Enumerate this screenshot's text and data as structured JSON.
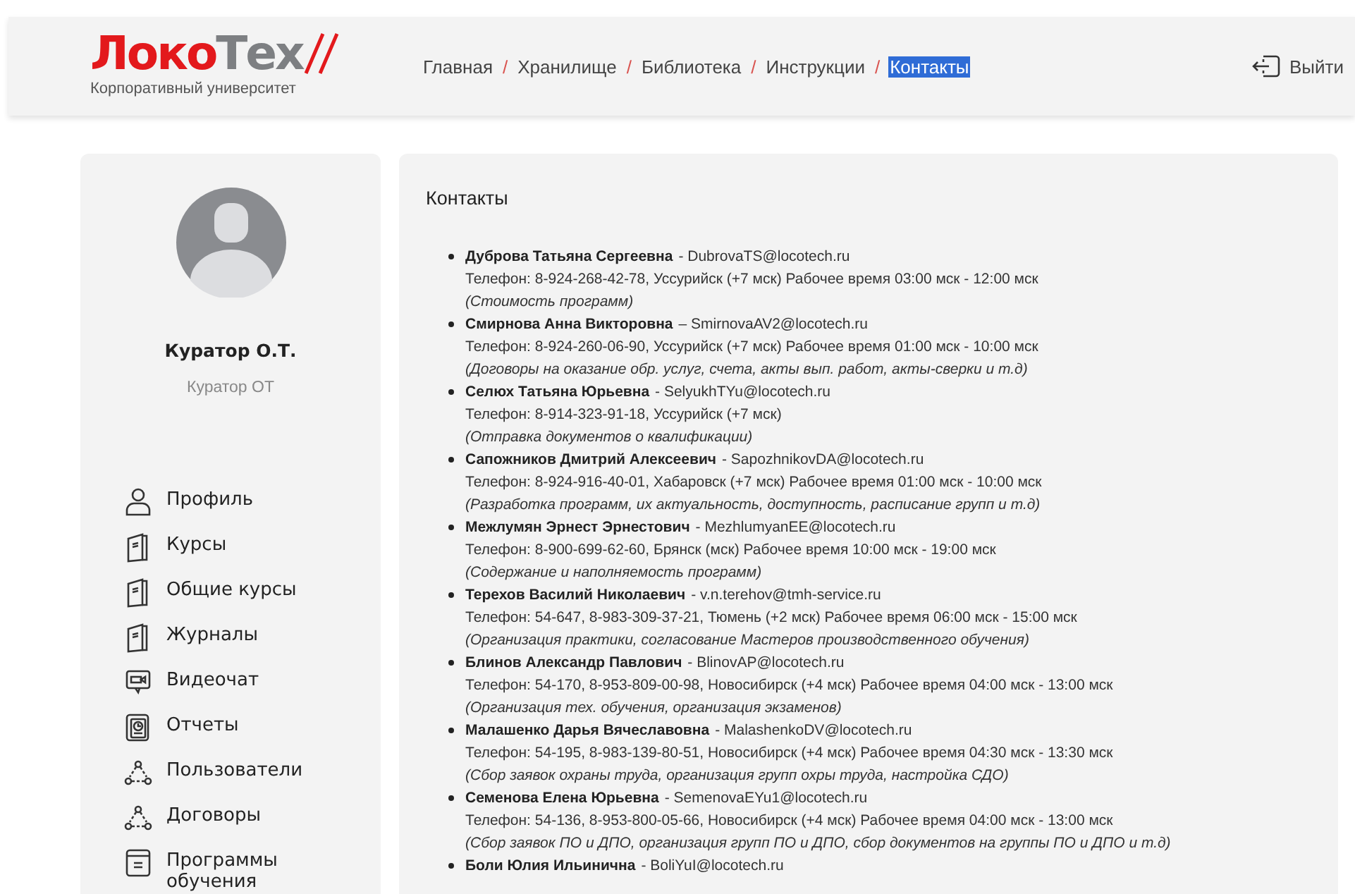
{
  "header": {
    "logo": {
      "part_1": "Локо",
      "part_2": "Тех",
      "subtitle": "Корпоративный университет"
    },
    "breadcrumbs": [
      {
        "label": "Главная",
        "separator": "/",
        "selected": false
      },
      {
        "label": "Хранилище",
        "separator": "/",
        "selected": false
      },
      {
        "label": "Библиотека",
        "separator": "/",
        "selected": false
      },
      {
        "label": "Инструкции",
        "separator": "/",
        "selected": false
      },
      {
        "label": "Контакты",
        "selected": true
      }
    ],
    "logout": "Выйти"
  },
  "sidebar": {
    "user_name": "Куратор О.Т.",
    "user_role": "Куратор ОТ",
    "menu": [
      {
        "label": "Профиль",
        "kind": "person"
      },
      {
        "label": "Курсы",
        "kind": "book"
      },
      {
        "label": "Общие курсы",
        "kind": "book"
      },
      {
        "label": "Журналы",
        "kind": "book"
      },
      {
        "label": "Видеочат",
        "kind": "video"
      },
      {
        "label": "Отчеты",
        "kind": "report"
      },
      {
        "label": "Пользователи",
        "kind": "network"
      },
      {
        "label": "Договоры",
        "kind": "network"
      },
      {
        "label": "Программы обучения",
        "kind": "program"
      }
    ]
  },
  "contacts": {
    "title": "Контакты",
    "items": [
      {
        "name": "Дуброва Татьяна Сергеевна",
        "separator": "-",
        "email": "DubrovaTS@locotech.ru",
        "phone": "Телефон: 8-924-268-42-78, Уссурийск (+7 мск) Рабочее время 03:00 мск - 12:00 мск",
        "note": "(Стоимость программ)"
      },
      {
        "name": "Смирнова Анна Викторовна",
        "separator": "–",
        "email": "SmirnovaAV2@locotech.ru",
        "phone": "Телефон: 8-924-260-06-90, Уссурийск (+7 мск) Рабочее время 01:00 мск - 10:00 мск",
        "note": "(Договоры на оказание обр. услуг, счета, акты вып. работ, акты-сверки и т.д)"
      },
      {
        "name": "Селюх Татьяна Юрьевна",
        "separator": "-",
        "email": "SelyukhTYu@locotech.ru",
        "phone": "Телефон: 8-914-323-91-18, Уссурийск (+7 мск)",
        "note": "(Отправка документов о квалификации)"
      },
      {
        "name": "Сапожников Дмитрий Алексеевич",
        "separator": "-",
        "email": "SapozhnikovDA@locotech.ru",
        "phone": "Телефон: 8-924-916-40-01, Хабаровск (+7 мск) Рабочее время 01:00 мск - 10:00 мск",
        "note": "(Разработка программ, их актуальность, доступность, расписание групп и т.д)"
      },
      {
        "name": "Межлумян Эрнест Эрнестович",
        "separator": "-",
        "email": "MezhlumyanEE@locotech.ru",
        "phone": "Телефон: 8-900-699-62-60, Брянск (мск) Рабочее время 10:00 мск - 19:00 мск",
        "note": "(Содержание и наполняемость программ)"
      },
      {
        "name": "Терехов Василий Николаевич",
        "separator": "-",
        "email": "v.n.terehov@tmh-service.ru",
        "phone": "Телефон: 54-647, 8-983-309-37-21, Тюмень (+2 мск) Рабочее время 06:00 мск - 15:00 мск",
        "note": "(Организация практики, согласование Мастеров производственного обучения)"
      },
      {
        "name": "Блинов Александр Павлович",
        "separator": "-",
        "email": "BlinovAP@locotech.ru",
        "phone": "Телефон: 54-170, 8-953-809-00-98, Новосибирск (+4 мск) Рабочее время 04:00 мск - 13:00 мск",
        "note": "(Организация тех. обучения, организация экзаменов)"
      },
      {
        "name": "Малашенко Дарья Вячеславовна",
        "separator": "-",
        "email": "MalashenkoDV@locotech.ru",
        "phone": "Телефон: 54-195, 8-983-139-80-51, Новосибирск (+4 мск) Рабочее время 04:30 мск - 13:30 мск",
        "note": "(Сбор заявок охраны труда, организация групп охры труда, настройка СДО)"
      },
      {
        "name": "Семенова Елена Юрьевна",
        "separator": "-",
        "email": "SemenovaEYu1@locotech.ru",
        "phone": "Телефон: 54-136, 8-953-800-05-66, Новосибирск (+4 мск) Рабочее время 04:00 мск - 13:00 мск",
        "note": "(Сбор заявок ПО и ДПО, организация групп ПО и ДПО, сбор документов на группы ПО и ДПО и т.д)"
      },
      {
        "name": "Боли Юлия Ильинична",
        "separator": "-",
        "email": "BoliYuI@locotech.ru"
      }
    ]
  }
}
